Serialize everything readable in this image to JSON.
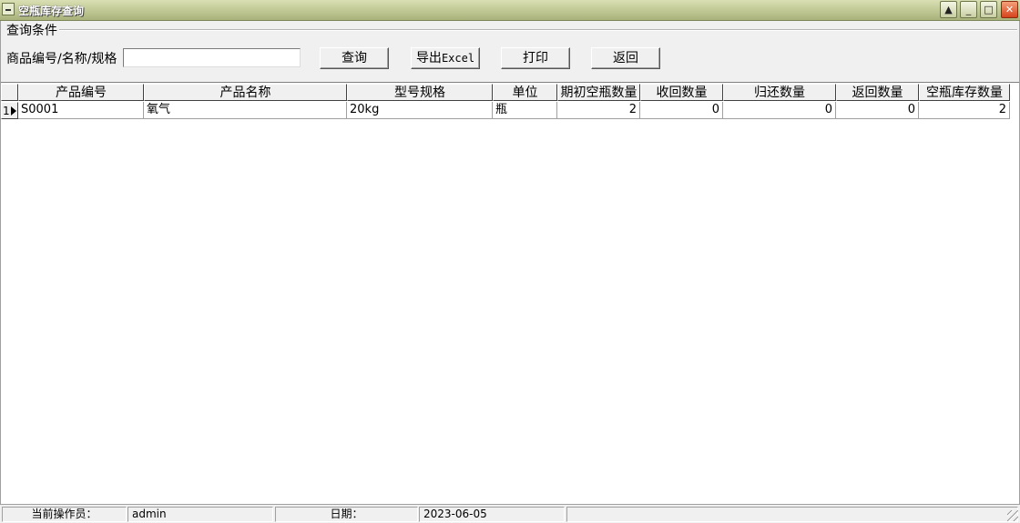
{
  "window": {
    "title": "空瓶库存查询",
    "controls": {
      "minimize_icon": "_",
      "help_icon": "▲",
      "maximize_icon": "□",
      "close_icon": "✕"
    }
  },
  "query": {
    "group_title": "查询条件",
    "search_label": "商品编号/名称/规格",
    "search_value": "",
    "search_placeholder": "",
    "buttons": {
      "query": "查询",
      "export_prefix": "导出",
      "export_suffix": "Excel",
      "print": "打印",
      "back": "返回"
    }
  },
  "grid": {
    "columns": [
      "产品编号",
      "产品名称",
      "型号规格",
      "单位",
      "期初空瓶数量",
      "收回数量",
      "归还数量",
      "返回数量",
      "空瓶库存数量"
    ],
    "rows": [
      {
        "index": "1",
        "code": "S0001",
        "name": "氧气",
        "spec": "20kg",
        "unit": "瓶",
        "opening": "2",
        "recovered": "0",
        "returned": "0",
        "sent_back": "0",
        "stock": "2"
      }
    ]
  },
  "status": {
    "operator_label": "当前操作员：",
    "operator_value": "admin",
    "date_label": "日期：",
    "date_value": "2023-06-05"
  }
}
